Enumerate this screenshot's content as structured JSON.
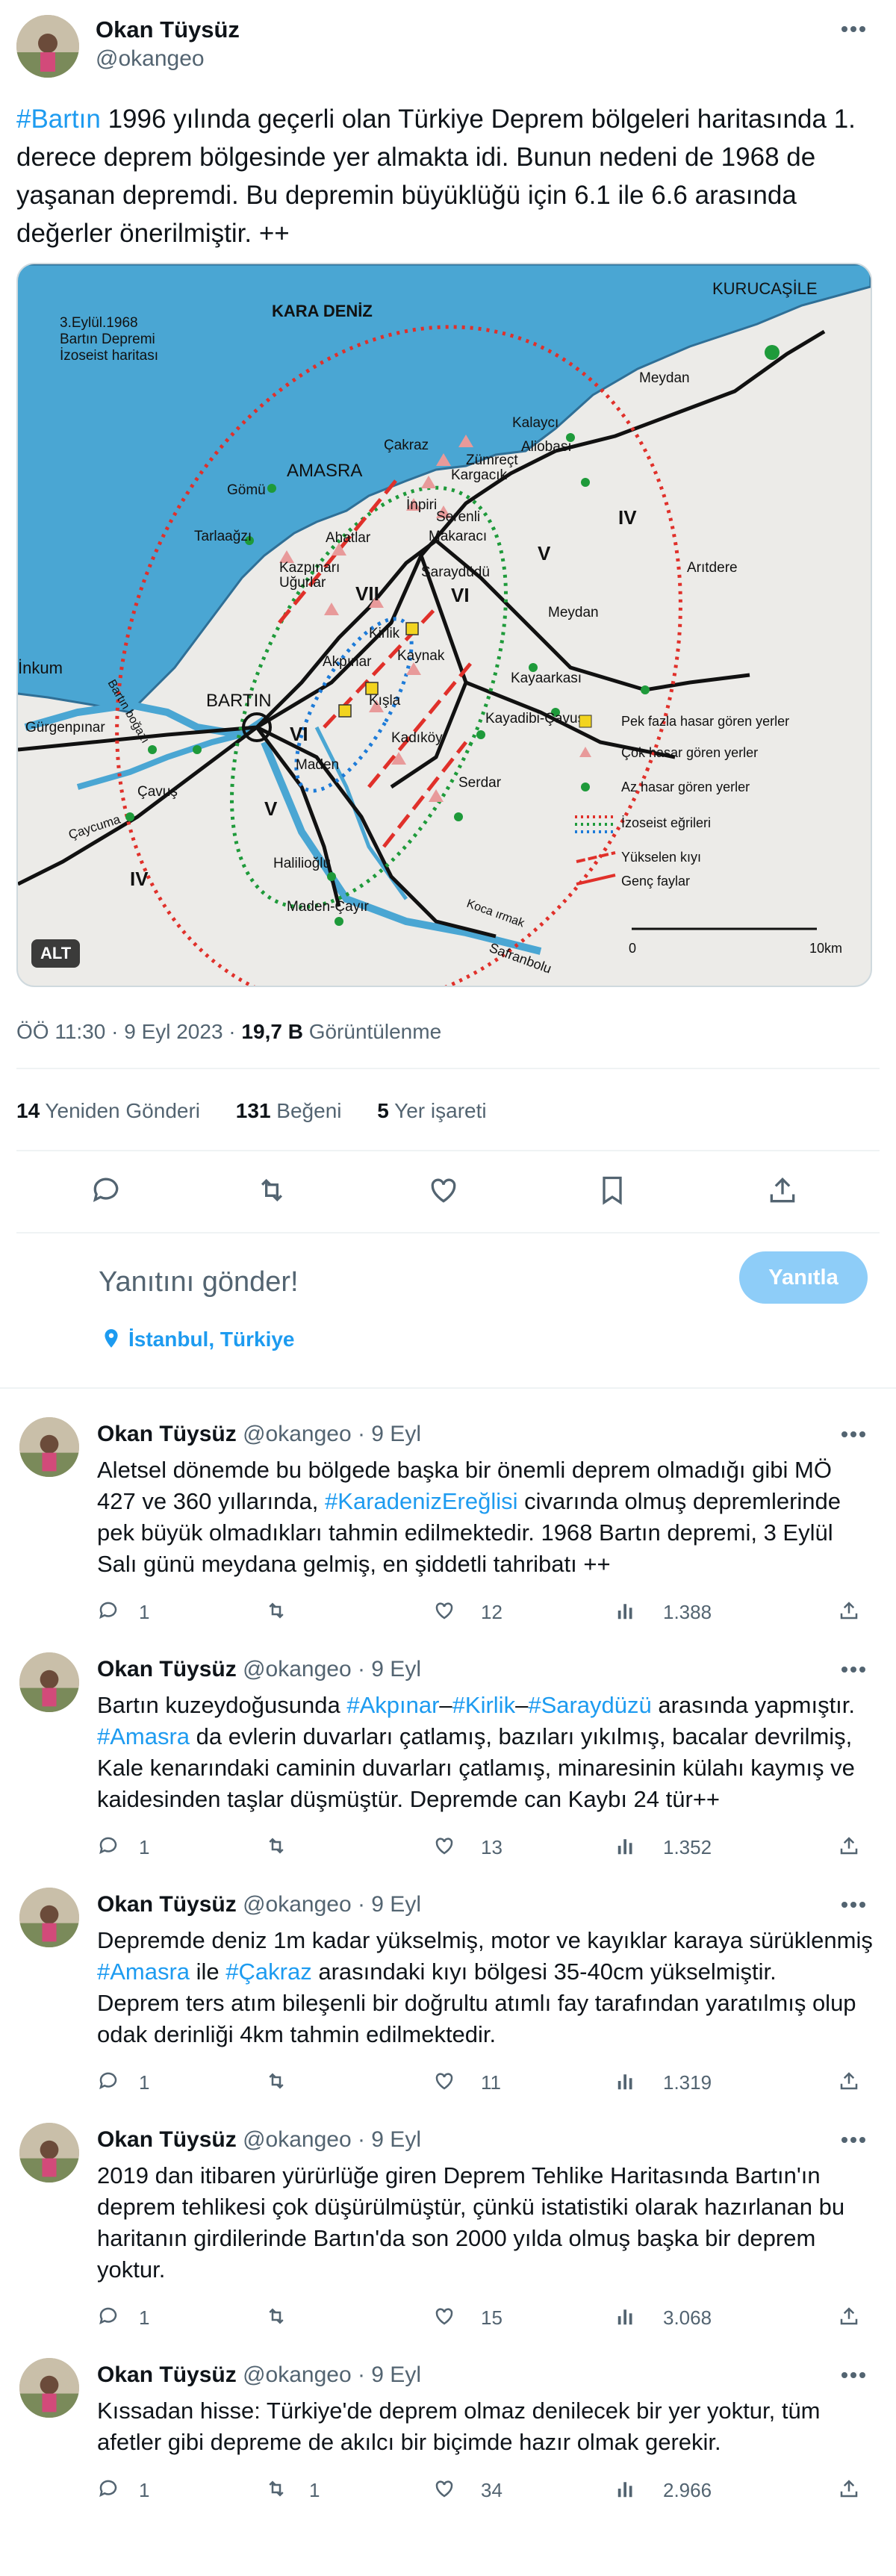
{
  "main": {
    "author_name": "Okan Tüysüz",
    "handle": "@okangeo",
    "text_segments": [
      {
        "t": "#Bartın",
        "link": true
      },
      {
        "t": " 1996 yılında geçerli olan Türkiye Deprem bölgeleri haritasında 1. derece deprem bölgesinde yer almakta idi. Bunun nedeni de 1968 de yaşanan depremdi. Bu depremin büyüklüğü için 6.1 ile 6.6 arasında değerler önerilmiştir. ++",
        "link": false
      }
    ],
    "alt_badge": "ALT",
    "timestamp": "ÖÖ 11:30 · 9 Eyl 2023 · ",
    "views_count": "19,7 B",
    "views_label": " Görüntülenme",
    "retweets_count": "14",
    "retweets_label": " Yeniden Gönderi",
    "likes_count": "131",
    "likes_label": " Beğeni",
    "bookmarks_count": "5",
    "bookmarks_label": " Yer işareti"
  },
  "map": {
    "title_lines": [
      "3.Eylül.1968",
      "Bartın Depremi",
      "İzoseist haritası"
    ],
    "sea_label": "KARA DENİZ",
    "places": {
      "kurucasile": "KURUCAŞİLE",
      "meydan1": "Meydan",
      "kalayci": "Kalaycı",
      "aliobasi": "Aliobası",
      "cakraz": "Çakraz",
      "amasra": "AMASRA",
      "zumrect": "Zümreçt",
      "kargacik": "Kargacık",
      "inpiri": "İnpiri",
      "serenli": "Serenli",
      "makaraci": "Makaracı",
      "ahatlar": "Ahatlar",
      "gomu": "Gömü",
      "tarlaagzi": "Tarlaağzı",
      "kazpinari": "Kazpınarı",
      "ugurlar": "Uğurlar",
      "saraydudu": "Saraydüdü",
      "kirlik": "Kirlik",
      "akpinar": "Akpınar",
      "kaynak": "Kaynak",
      "kisla": "Kışla",
      "kadikoy": "Kadıköy",
      "inkum": "İnkum",
      "bartin_bogazi": "Bartın boğazı",
      "bartin": "BARTIN",
      "gurgenpinar": "Gürgenpınar",
      "cavus": "Çavuş",
      "caycuma": "Çaycuma",
      "maden": "Maden",
      "serdar": "Serdar",
      "meydan2": "Meydan",
      "kayaarkasi": "Kayaarkası",
      "kayadibi": "Kayadibi-Çavuş",
      "aritdere": "Arıtdere",
      "halilioglu": "Halilioğlu",
      "maden_cayir": "Maden-Çayır",
      "koca_irmak": "Koca ırmak",
      "safranbolu": "Safranbolu"
    },
    "intensity": {
      "iv1": "IV",
      "v1": "V",
      "vi1": "VI",
      "vii": "VII",
      "vi2": "VI",
      "v2": "V",
      "iv2": "IV"
    },
    "legend": {
      "pek_fazla": "Pek fazla hasar gören yerler",
      "cok": "Çok hasar gören yerler",
      "az": "Az hasar gören yerler",
      "izoseist": "İzoseist eğrileri",
      "yukselen": "Yükselen kıyı",
      "genc": "Genç faylar"
    },
    "scale_start": "0",
    "scale_end": "10km"
  },
  "actions": {
    "reply_placeholder": "Yanıtını gönder!",
    "reply_button": "Yanıtla",
    "location": "İstanbul, Türkiye"
  },
  "replies": [
    {
      "name": "Okan Tüysüz",
      "meta": "@okangeo · 9 Eyl",
      "lines": [
        [
          {
            "t": "Aletsel dönemde bu bölgede başka bir önemli deprem olmadığı gibi MÖ",
            "link": false
          }
        ],
        [
          {
            "t": "427 ve 360 yıllarında, ",
            "link": false
          },
          {
            "t": "#KaradenizEreğlisi",
            "link": true
          },
          {
            "t": " civarında olmuş depremlerinde",
            "link": false
          }
        ],
        [
          {
            "t": "pek büyük olmadıkları tahmin edilmektedir. 1968 Bartın depremi, 3 Eylül",
            "link": false
          }
        ],
        [
          {
            "t": "Salı günü meydana gelmiş, en şiddetli tahribatı ++",
            "link": false
          }
        ]
      ],
      "replies": "1",
      "retweets": "",
      "likes": "12",
      "views": "1.388"
    },
    {
      "name": "Okan Tüysüz",
      "meta": "@okangeo · 9 Eyl",
      "lines": [
        [
          {
            "t": "Bartın kuzeydoğusunda ",
            "link": false
          },
          {
            "t": "#Akpınar",
            "link": true
          },
          {
            "t": "–",
            "link": false
          },
          {
            "t": "#Kirlik",
            "link": true
          },
          {
            "t": "–",
            "link": false
          },
          {
            "t": "#Saraydüzü",
            "link": true
          },
          {
            "t": " arasında yapmıştır.",
            "link": false
          }
        ],
        [
          {
            "t": "#Amasra",
            "link": true
          },
          {
            "t": " da evlerin duvarları çatlamış, bazıları yıkılmış, bacalar devrilmiş,",
            "link": false
          }
        ],
        [
          {
            "t": "Kale kenarındaki caminin duvarları çatlamış, minaresinin külahı kaymış ve",
            "link": false
          }
        ],
        [
          {
            "t": "kaidesinden  taşlar düşmüştür. Depremde can Kaybı 24 tür++",
            "link": false
          }
        ]
      ],
      "replies": "1",
      "retweets": "",
      "likes": "13",
      "views": "1.352"
    },
    {
      "name": "Okan Tüysüz",
      "meta": "@okangeo · 9 Eyl",
      "lines": [
        [
          {
            "t": "Depremde deniz 1m kadar yükselmiş, motor ve kayıklar karaya sürüklenmiş",
            "link": false
          }
        ],
        [
          {
            "t": "#Amasra",
            "link": true
          },
          {
            "t": " ile ",
            "link": false
          },
          {
            "t": "#Çakraz",
            "link": true
          },
          {
            "t": " arasındaki kıyı bölgesi 35-40cm yükselmiştir.",
            "link": false
          }
        ],
        [
          {
            "t": "Deprem ters atım bileşenli bir doğrultu atımlı fay tarafından yaratılmış olup",
            "link": false
          }
        ],
        [
          {
            "t": "odak derinliği 4km tahmin edilmektedir.",
            "link": false
          }
        ]
      ],
      "replies": "1",
      "retweets": "",
      "likes": "11",
      "views": "1.319"
    },
    {
      "name": "Okan Tüysüz",
      "meta": "@okangeo · 9 Eyl",
      "lines": [
        [
          {
            "t": "2019 dan itibaren yürürlüğe giren Deprem Tehlike Haritasında Bartın'ın",
            "link": false
          }
        ],
        [
          {
            "t": "deprem tehlikesi çok düşürülmüştür, çünkü istatistiki olarak hazırlanan bu",
            "link": false
          }
        ],
        [
          {
            "t": "haritanın girdilerinde Bartın'da son 2000 yılda olmuş başka bir deprem",
            "link": false
          }
        ],
        [
          {
            "t": "yoktur.",
            "link": false
          }
        ]
      ],
      "replies": "1",
      "retweets": "",
      "likes": "15",
      "views": "3.068"
    },
    {
      "name": "Okan Tüysüz",
      "meta": "@okangeo · 9 Eyl",
      "lines": [
        [
          {
            "t": "Kıssadan hisse: Türkiye'de deprem olmaz denilecek bir yer yoktur, tüm",
            "link": false
          }
        ],
        [
          {
            "t": "afetler gibi depreme de akılcı bir biçimde hazır olmak gerekir.",
            "link": false
          }
        ]
      ],
      "replies": "1",
      "retweets": "1",
      "likes": "34",
      "views": "2.966"
    }
  ],
  "colors": {
    "accent": "#1d9bf0",
    "text": "#0f1419",
    "muted": "#536471",
    "sea": "#3aa8d8",
    "reply_button": "#8ecdf8"
  }
}
